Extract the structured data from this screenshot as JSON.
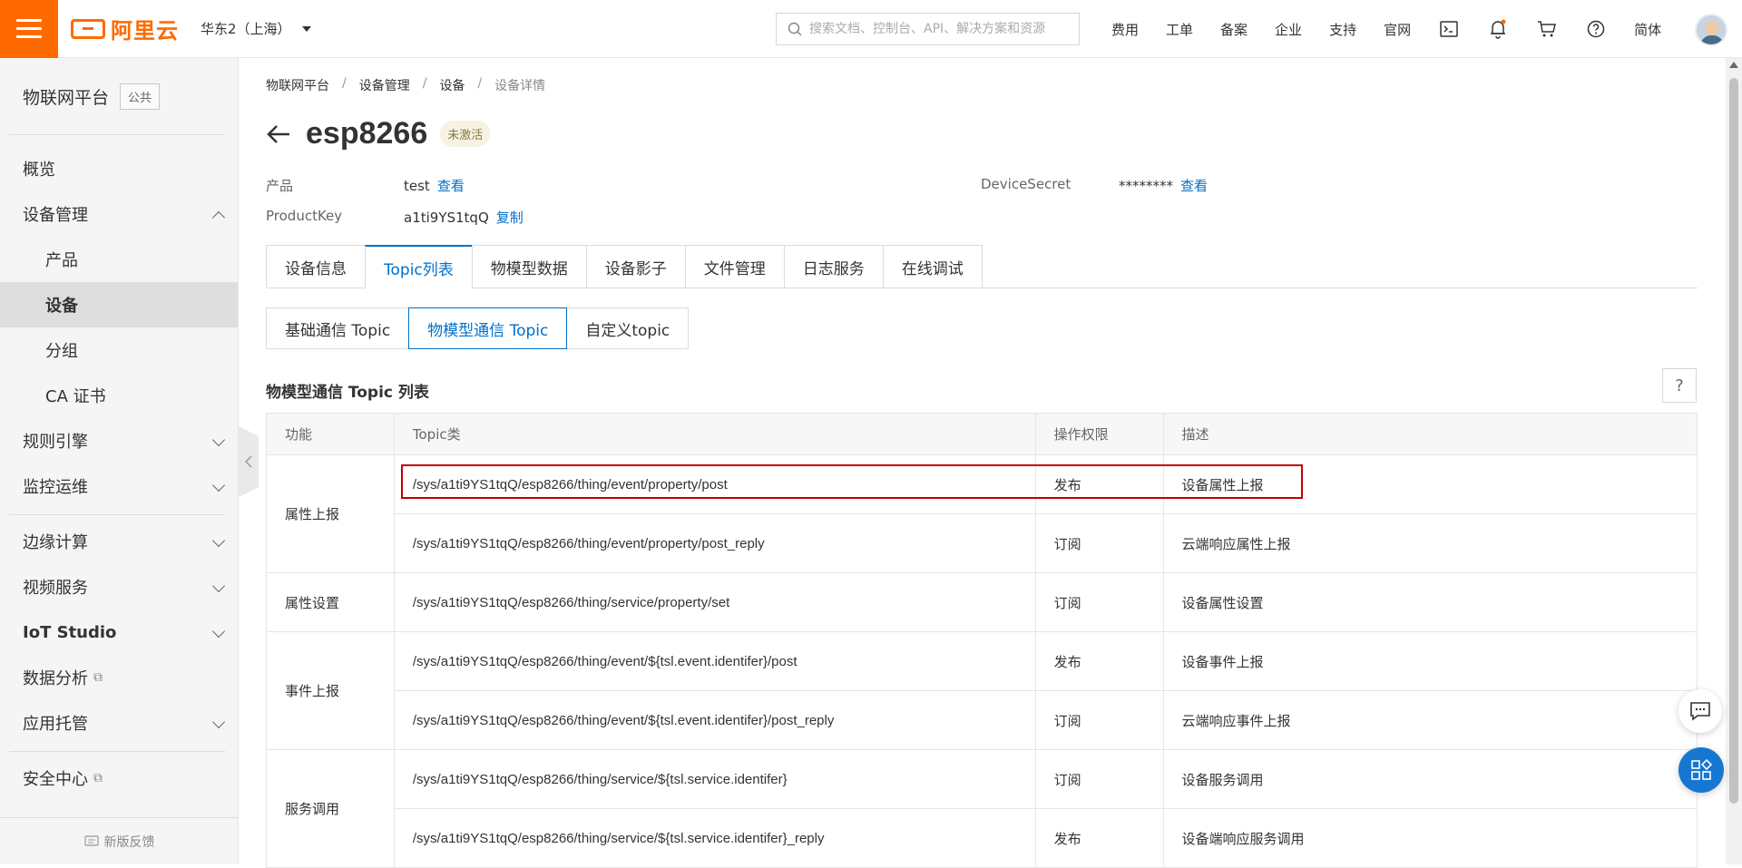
{
  "header": {
    "logo_text": "阿里云",
    "region": "华东2（上海）",
    "search_placeholder": "搜索文档、控制台、API、解决方案和资源",
    "nav": [
      "费用",
      "工单",
      "备案",
      "企业",
      "支持",
      "官网"
    ],
    "language": "简体",
    "brand_color": "#ff6a00"
  },
  "sidebar": {
    "title": "物联网平台",
    "badge": "公共",
    "items": [
      {
        "label": "概览"
      },
      {
        "label": "设备管理"
      },
      {
        "label": "产品"
      },
      {
        "label": "设备"
      },
      {
        "label": "分组"
      },
      {
        "label": "CA 证书"
      },
      {
        "label": "规则引擎"
      },
      {
        "label": "监控运维"
      },
      {
        "label": "边缘计算"
      },
      {
        "label": "视频服务"
      },
      {
        "label": "IoT Studio"
      },
      {
        "label": "数据分析"
      },
      {
        "label": "应用托管"
      },
      {
        "label": "安全中心"
      }
    ],
    "feedback": "新版反馈"
  },
  "breadcrumb": [
    "物联网平台",
    "设备管理",
    "设备",
    "设备详情"
  ],
  "device": {
    "name": "esp8266",
    "status": "未激活",
    "product_label": "产品",
    "product_value": "test",
    "product_link": "查看",
    "productkey_label": "ProductKey",
    "productkey_value": "a1ti9YS1tqQ",
    "productkey_link": "复制",
    "secret_label": "DeviceSecret",
    "secret_value": "********",
    "secret_link": "查看"
  },
  "tabs": [
    "设备信息",
    "Topic列表",
    "物模型数据",
    "设备影子",
    "文件管理",
    "日志服务",
    "在线调试"
  ],
  "subtabs": [
    "基础通信 Topic",
    "物模型通信 Topic",
    "自定义topic"
  ],
  "section": {
    "title": "物模型通信 Topic 列表",
    "help": "?"
  },
  "table": {
    "headers": [
      "功能",
      "Topic类",
      "操作权限",
      "描述"
    ],
    "groups": [
      {
        "func": "属性上报",
        "rows": [
          {
            "topic": "/sys/a1ti9YS1tqQ/esp8266/thing/event/property/post",
            "perm": "发布",
            "desc": "设备属性上报"
          },
          {
            "topic": "/sys/a1ti9YS1tqQ/esp8266/thing/event/property/post_reply",
            "perm": "订阅",
            "desc": "云端响应属性上报"
          }
        ]
      },
      {
        "func": "属性设置",
        "rows": [
          {
            "topic": "/sys/a1ti9YS1tqQ/esp8266/thing/service/property/set",
            "perm": "订阅",
            "desc": "设备属性设置"
          }
        ]
      },
      {
        "func": "事件上报",
        "rows": [
          {
            "topic": "/sys/a1ti9YS1tqQ/esp8266/thing/event/${tsl.event.identifer}/post",
            "perm": "发布",
            "desc": "设备事件上报"
          },
          {
            "topic": "/sys/a1ti9YS1tqQ/esp8266/thing/event/${tsl.event.identifer}/post_reply",
            "perm": "订阅",
            "desc": "云端响应事件上报"
          }
        ]
      },
      {
        "func": "服务调用",
        "rows": [
          {
            "topic": "/sys/a1ti9YS1tqQ/esp8266/thing/service/${tsl.service.identifer}",
            "perm": "订阅",
            "desc": "设备服务调用"
          },
          {
            "topic": "/sys/a1ti9YS1tqQ/esp8266/thing/service/${tsl.service.identifer}_reply",
            "perm": "发布",
            "desc": "设备端响应服务调用"
          }
        ]
      }
    ]
  }
}
